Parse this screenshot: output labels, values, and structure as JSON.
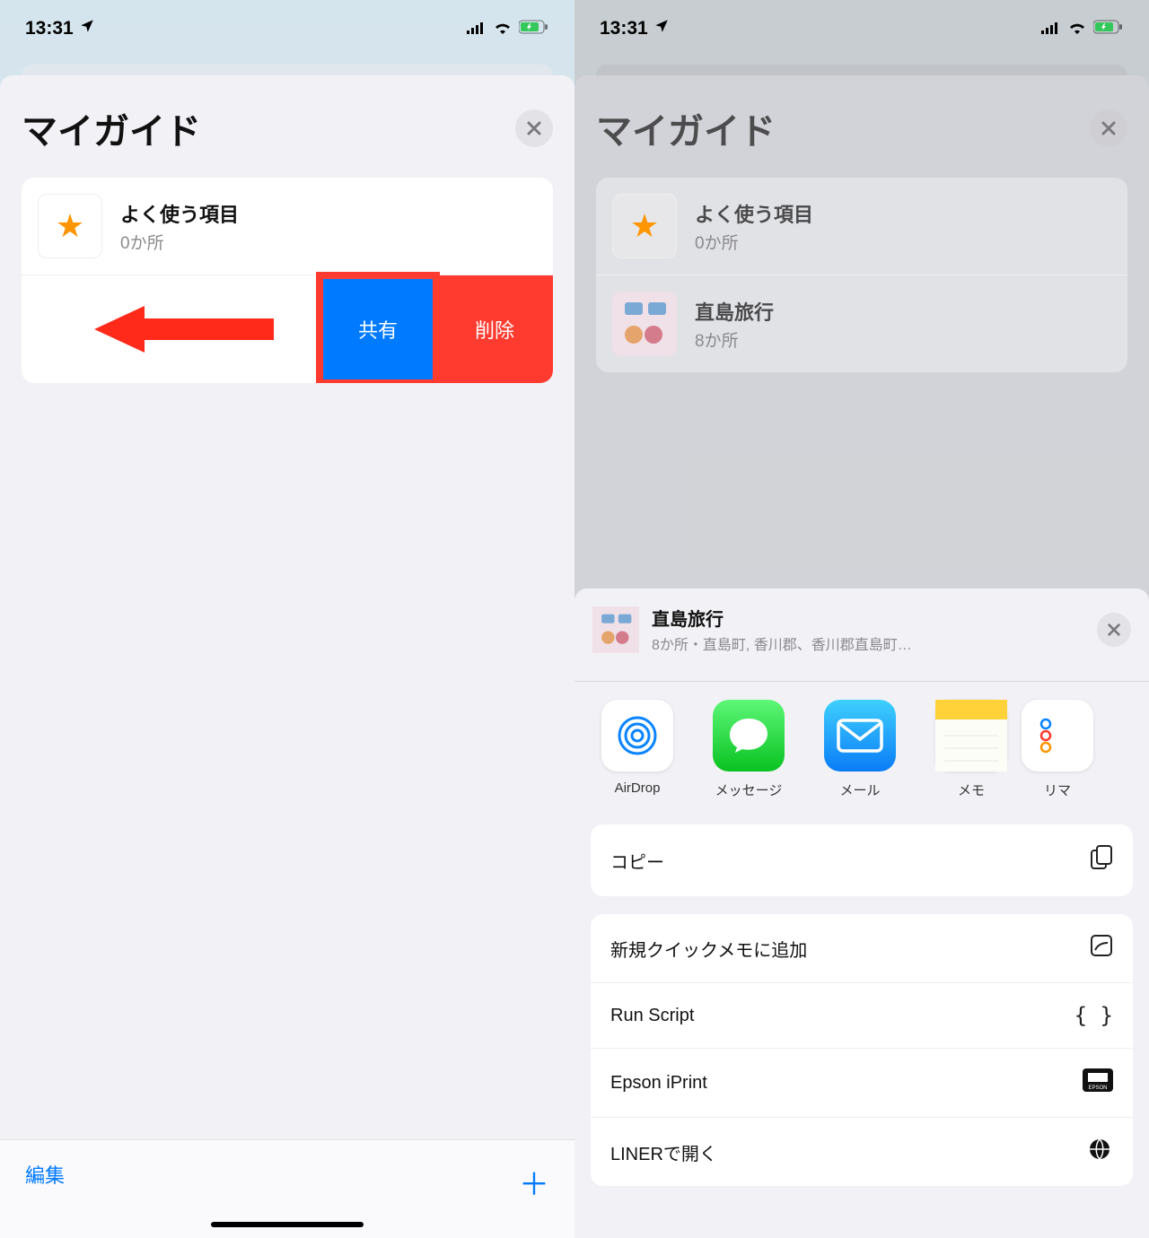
{
  "status": {
    "time": "13:31",
    "signal": "llll",
    "wifi": true,
    "battery_charging": true
  },
  "left": {
    "title": "マイガイド",
    "favorites": {
      "name": "よく使う項目",
      "count": "0か所"
    },
    "swipe": {
      "share": "共有",
      "delete": "削除"
    },
    "bottom": {
      "edit": "編集",
      "add": "+"
    }
  },
  "right": {
    "title": "マイガイド",
    "favorites": {
      "name": "よく使う項目",
      "count": "0か所"
    },
    "guide": {
      "name": "直島旅行",
      "count": "8か所"
    },
    "share_sheet": {
      "title": "直島旅行",
      "subtitle": "8か所・直島町, 香川郡、香川郡直島町…",
      "apps": [
        {
          "label": "AirDrop"
        },
        {
          "label": "メッセージ"
        },
        {
          "label": "メール"
        },
        {
          "label": "メモ"
        },
        {
          "label": "リマ"
        }
      ],
      "actions": [
        {
          "label": "コピー",
          "icon": "copy"
        },
        {
          "label": "新規クイックメモに追加",
          "icon": "quicknote"
        },
        {
          "label": "Run Script",
          "icon": "braces"
        },
        {
          "label": "Epson iPrint",
          "icon": "epson"
        },
        {
          "label": "LINERで開く",
          "icon": "liner"
        }
      ]
    }
  }
}
